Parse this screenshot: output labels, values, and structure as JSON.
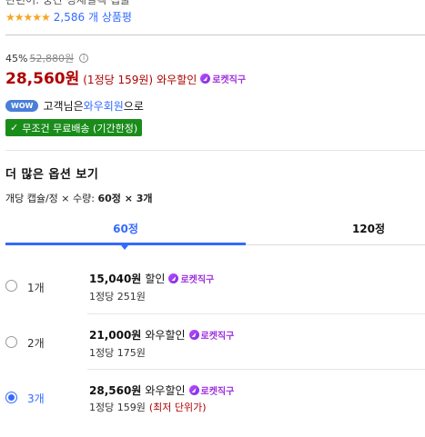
{
  "header": {
    "cut_title": "관련어: 중간 성재컬렉 캡술",
    "review_count": "2,586 개 상품평",
    "rating": 5
  },
  "price": {
    "discount_rate": "45%",
    "original": "52,880원",
    "current": "28,560원",
    "unit_price": "(1정당 159원)",
    "discount_label": "와우할인",
    "rocket_label": "로켓직구"
  },
  "wow": {
    "badge": "WOW",
    "text_before": "고객님은 ",
    "member_link": "와우회원",
    "text_after": "으로"
  },
  "shipping": {
    "label": "무조건 무료배송 (기간한정)"
  },
  "options": {
    "title": "더 많은 옵션 보기",
    "summary_prefix": "개당 캡슐/정 × 수량: ",
    "summary_value": "60정 × 3개",
    "tabs": [
      "60정",
      "120정"
    ],
    "items": [
      {
        "qty": "1개",
        "price": "15,040원",
        "discount": "할인",
        "rocket": "로켓직구",
        "unit": "1정당 251원",
        "note": "",
        "selected": false
      },
      {
        "qty": "2개",
        "price": "21,000원",
        "discount": "와우할인",
        "rocket": "로켓직구",
        "unit": "1정당 175원",
        "note": "",
        "selected": false
      },
      {
        "qty": "3개",
        "price": "28,560원",
        "discount": "와우할인",
        "rocket": "로켓직구",
        "unit": "1정당 159원",
        "note": "(최저 단위가)",
        "selected": true
      }
    ]
  },
  "colors": {
    "accent": "#346aff",
    "price_red": "#ae0000",
    "rocket_purple": "#9f2fdf",
    "free_ship_green": "#1a8c1a"
  }
}
